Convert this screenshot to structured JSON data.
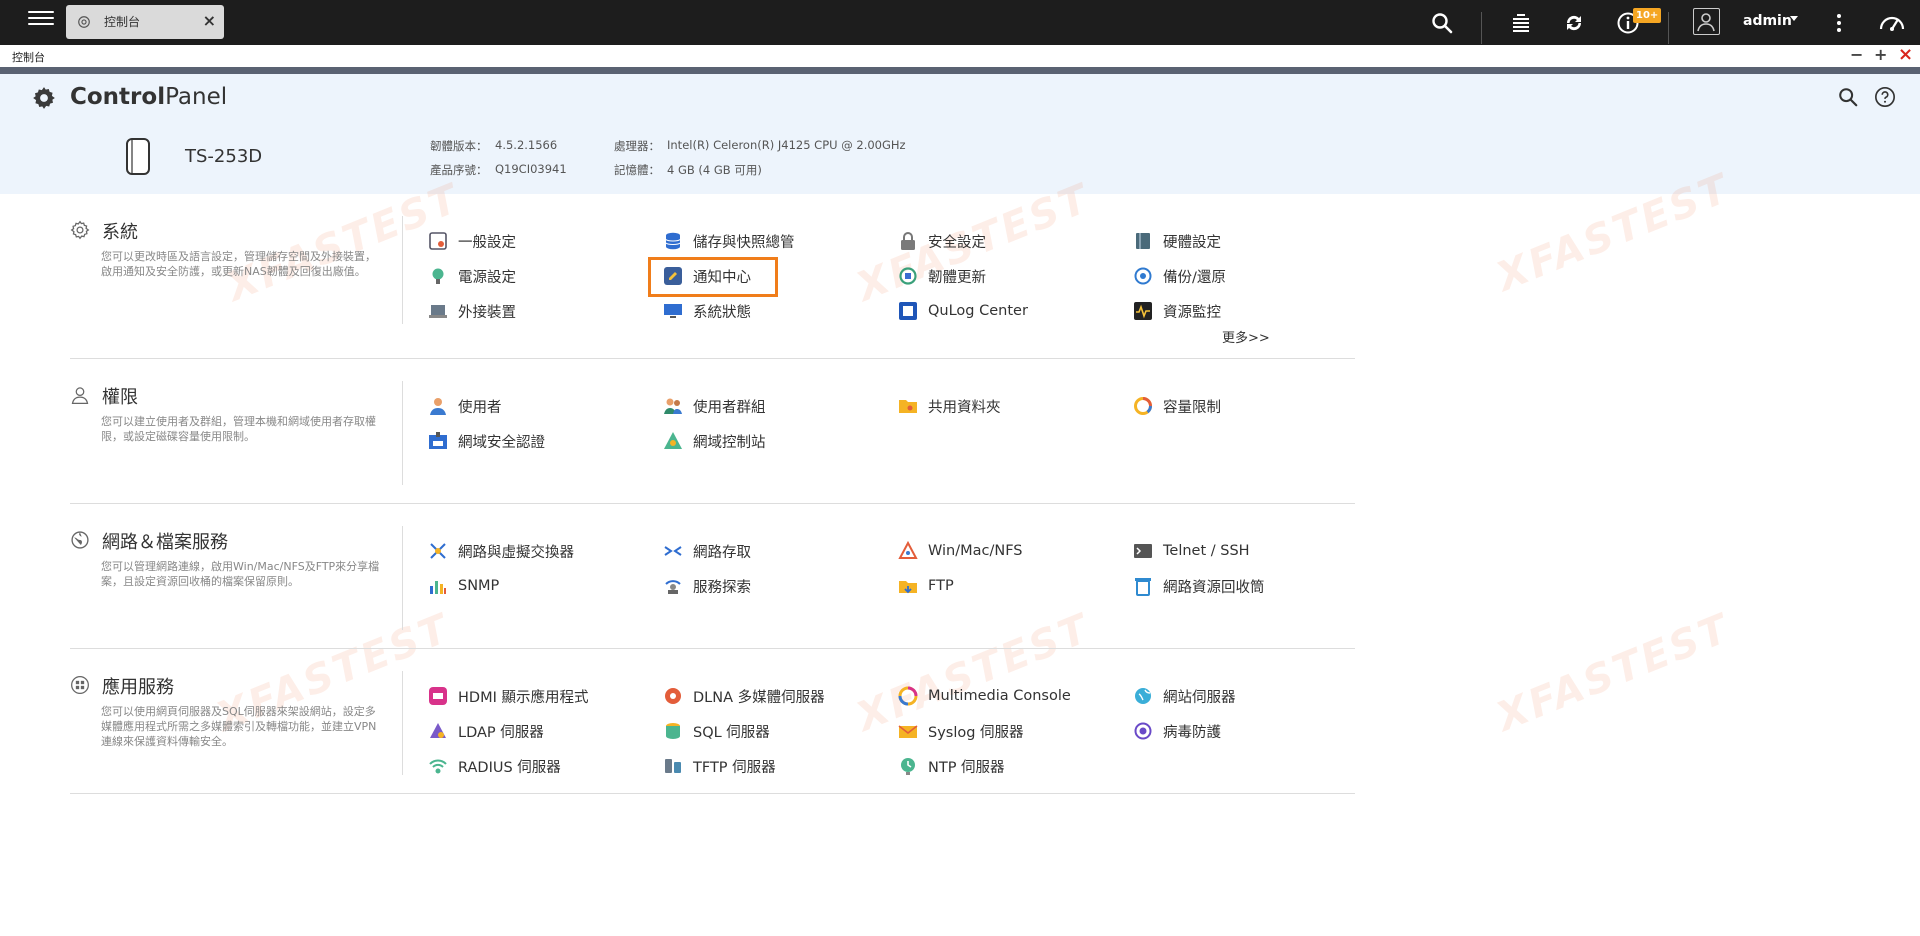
{
  "topbar": {
    "tab_label": "控制台",
    "tab_close": "×",
    "notification_badge": "10+",
    "username": "admin"
  },
  "window": {
    "title": "控制台",
    "minimize": "−",
    "maximize": "+",
    "close": "×"
  },
  "header": {
    "title_bold": "Control",
    "title_light": "Panel",
    "model": "TS-253D",
    "firmware_label": "韌體版本：",
    "firmware_value": "4.5.2.1566",
    "serial_label": "產品序號：",
    "serial_value": "Q19CI03941",
    "cpu_label": "處理器：",
    "cpu_value": "Intel(R) Celeron(R) J4125 CPU @ 2.00GHz",
    "memory_label": "記憶體：",
    "memory_value": "4 GB (4 GB 可用)"
  },
  "sections": [
    {
      "title": "系統",
      "desc": "您可以更改時區及語言設定，管理儲存空間及外接裝置，啟用通知及安全防護，或更新NAS韌體及回復出廠值。",
      "more": "更多>>",
      "items": [
        "一般設定",
        "儲存與快照總管",
        "安全設定",
        "硬體設定",
        "電源設定",
        "通知中心",
        "韌體更新",
        "備份/還原",
        "外接裝置",
        "系統狀態",
        "QuLog Center",
        "資源監控"
      ]
    },
    {
      "title": "權限",
      "desc": "您可以建立使用者及群組，管理本機和網域使用者存取權限，或設定磁碟容量使用限制。",
      "items": [
        "使用者",
        "使用者群組",
        "共用資料夾",
        "容量限制",
        "網域安全認證",
        "網域控制站"
      ]
    },
    {
      "title": "網路＆檔案服務",
      "desc": "您可以管理網路連線，啟用Win/Mac/NFS及FTP來分享檔案，且設定資源回收桶的檔案保留原則。",
      "items": [
        "網路與虛擬交換器",
        "網路存取",
        "Win/Mac/NFS",
        "Telnet / SSH",
        "SNMP",
        "服務探索",
        "FTP",
        "網路資源回收筒"
      ]
    },
    {
      "title": "應用服務",
      "desc": "您可以使用網頁伺服器及SQL伺服器來架設網站，設定多媒體應用程式所需之多媒體索引及轉檔功能，並建立VPN連線來保護資料傳輸安全。",
      "items": [
        "HDMI 顯示應用程式",
        "DLNA 多媒體伺服器",
        "Multimedia Console",
        "網站伺服器",
        "LDAP 伺服器",
        "SQL 伺服器",
        "Syslog 伺服器",
        "病毒防護",
        "RADIUS 伺服器",
        "TFTP 伺服器",
        "NTP 伺服器"
      ]
    }
  ],
  "watermark": "XFASTEST"
}
